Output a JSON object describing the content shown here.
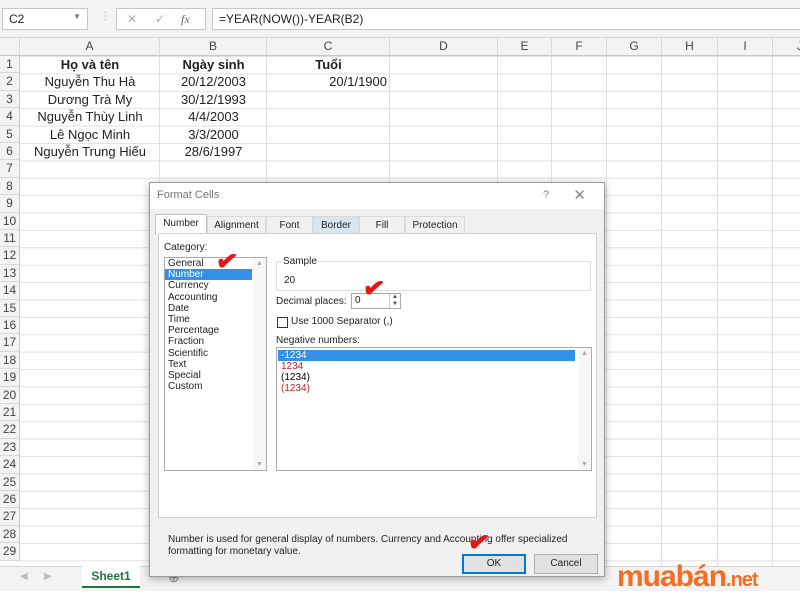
{
  "formula_bar": {
    "name_box": "C2",
    "cancel_icon": "✕",
    "enter_icon": "✓",
    "fx_label": "fx",
    "formula": "=YEAR(NOW())-YEAR(B2)"
  },
  "columns": [
    "A",
    "B",
    "C",
    "D",
    "E",
    "F",
    "G",
    "H",
    "I",
    "J"
  ],
  "rows": [
    "1",
    "2",
    "3",
    "4",
    "5",
    "6",
    "7",
    "8",
    "9",
    "10",
    "11",
    "12",
    "13",
    "14",
    "15",
    "16",
    "17",
    "18",
    "19",
    "20",
    "21",
    "22",
    "23",
    "24",
    "25",
    "26",
    "27",
    "28",
    "29"
  ],
  "table": {
    "headers": [
      "Họ và tên",
      "Ngày sinh",
      "Tuổi"
    ],
    "rows": [
      {
        "name": "Nguyễn Thu Hà",
        "dob": "20/12/2003",
        "age": "20/1/1900"
      },
      {
        "name": "Dương Trà My",
        "dob": "30/12/1993",
        "age": ""
      },
      {
        "name": "Nguyễn Thùy Linh",
        "dob": "4/4/2003",
        "age": ""
      },
      {
        "name": "Lê Ngọc Minh",
        "dob": "3/3/2000",
        "age": ""
      },
      {
        "name": "Nguyễn Trung Hiếu",
        "dob": "28/6/1997",
        "age": ""
      }
    ]
  },
  "sheet_tabs": {
    "active": "Sheet1",
    "add_icon": "⊕"
  },
  "dialog": {
    "title": "Format Cells",
    "help": "?",
    "close": "✕",
    "tabs": [
      "Number",
      "Alignment",
      "Font",
      "Border",
      "Fill",
      "Protection"
    ],
    "active_tab": "Number",
    "category_label": "Category:",
    "categories": [
      "General",
      "Number",
      "Currency",
      "Accounting",
      "Date",
      "Time",
      "Percentage",
      "Fraction",
      "Scientific",
      "Text",
      "Special",
      "Custom"
    ],
    "selected_category": "Number",
    "sample_label": "Sample",
    "sample_value": "20",
    "decimal_label": "Decimal places:",
    "decimal_value": "0",
    "separator_label": "Use 1000 Separator (,)",
    "separator_checked": false,
    "negative_label": "Negative numbers:",
    "negative_options": [
      {
        "text": "-1234",
        "color": "#000000"
      },
      {
        "text": "1234",
        "color": "#d02020"
      },
      {
        "text": "(1234)",
        "color": "#000000"
      },
      {
        "text": "(1234)",
        "color": "#d02020"
      }
    ],
    "description": "Number is used for general display of numbers.  Currency and Accounting offer specialized formatting for monetary value.",
    "ok": "OK",
    "cancel": "Cancel"
  },
  "watermark": {
    "text": "muabán",
    "suffix": ".net",
    "color": "#f26f21"
  },
  "annotation_color": "#e01818"
}
